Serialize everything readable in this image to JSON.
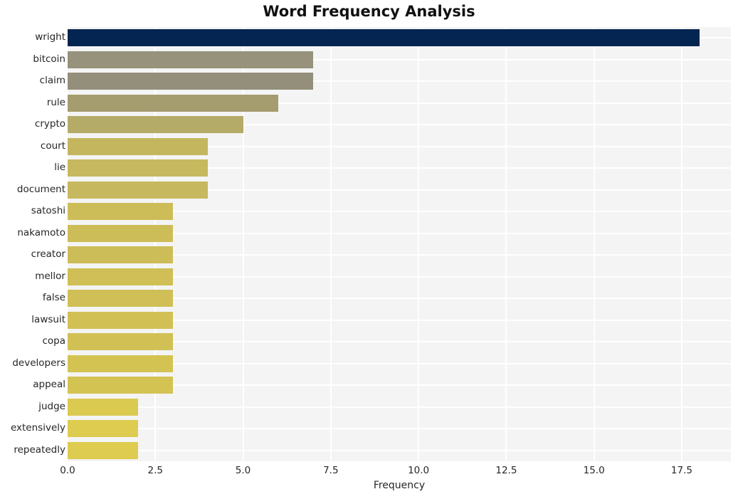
{
  "chart_data": {
    "type": "bar",
    "orientation": "horizontal",
    "title": "Word Frequency Analysis",
    "xlabel": "Frequency",
    "ylabel": "",
    "categories": [
      "wright",
      "bitcoin",
      "claim",
      "rule",
      "crypto",
      "court",
      "lie",
      "document",
      "satoshi",
      "nakamoto",
      "creator",
      "mellor",
      "false",
      "lawsuit",
      "copa",
      "developers",
      "appeal",
      "judge",
      "extensively",
      "repeatedly"
    ],
    "values": [
      18,
      7,
      7,
      6,
      5,
      4,
      4,
      4,
      3,
      3,
      3,
      3,
      3,
      3,
      3,
      3,
      3,
      2,
      2,
      2
    ],
    "bar_colors": [
      "#042552",
      "#97927c",
      "#948f7a",
      "#a59c6f",
      "#b5ab68",
      "#c4b65f",
      "#c6b85e",
      "#c6b85e",
      "#cdbd58",
      "#cdbd58",
      "#cdbd58",
      "#cfbf56",
      "#cfbf56",
      "#d1c154",
      "#d1c154",
      "#d3c353",
      "#d3c353",
      "#dbca50",
      "#ddcc4f",
      "#ddcc4f"
    ],
    "xlim": [
      0,
      18.9
    ],
    "xticks": [
      "0.0",
      "2.5",
      "5.0",
      "7.5",
      "10.0",
      "12.5",
      "15.0",
      "17.5"
    ],
    "xtick_values": [
      0,
      2.5,
      5,
      7.5,
      10,
      12.5,
      15,
      17.5
    ],
    "grid": true,
    "grid_color": "#ffffff",
    "plot_background": "#f4f4f4",
    "figure_background": "#ffffff",
    "legend": null,
    "legend_position": "none"
  }
}
